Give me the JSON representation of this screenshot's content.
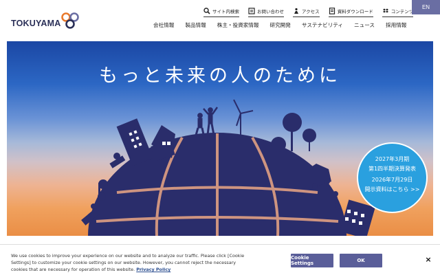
{
  "header": {
    "logo_text": "TOKUYAMA",
    "language_button": "EN",
    "utility_links": [
      {
        "label": "サイト内検索",
        "icon": "search-icon"
      },
      {
        "label": "お問い合わせ",
        "icon": "mail-icon"
      },
      {
        "label": "アクセス",
        "icon": "map-person-icon"
      },
      {
        "label": "資料ダウンロード",
        "icon": "document-icon"
      },
      {
        "label": "コンテンツ",
        "icon": "dropbox-icon"
      }
    ],
    "main_nav": [
      "会社情報",
      "製品情報",
      "株主・投資家情報",
      "研究開発",
      "サステナビリティ",
      "ニュース",
      "採用情報"
    ]
  },
  "hero": {
    "headline": "もっと未来の人のために",
    "ir_badge": {
      "line1": "2027年3月期",
      "line2": "第1四半期決算発表",
      "line3": "2026年7月29日",
      "line4": "開示資料はこちら",
      "arrow": ">>"
    }
  },
  "cookie_banner": {
    "text": "We use cookies to improve your experience on our website and to analyze our traffic. Please click [Cookie Settings] to customize your cookie settings on our website. However, you cannot reject the necessary cookies that are necessary for operation of this website.",
    "policy_link": "Privacy Policy",
    "settings_button": "Cookie Settings",
    "ok_button": "OK",
    "close_icon": "×"
  },
  "colors": {
    "brand": "#2a2f57",
    "accent": "#6a6ea3",
    "globe": "#2a2d6b",
    "badge": "#2aa0df"
  }
}
